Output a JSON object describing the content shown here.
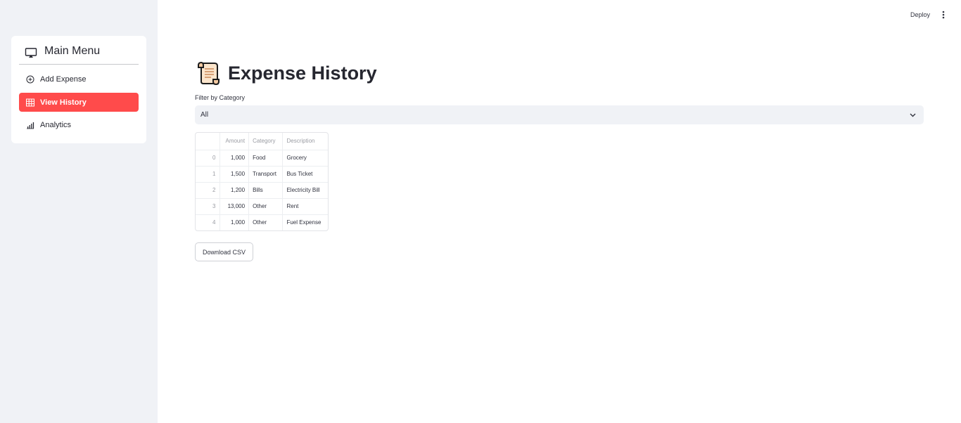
{
  "header": {
    "deploy_label": "Deploy",
    "menu_icon": "kebab-icon"
  },
  "sidebar": {
    "menu_title": "Main Menu",
    "menu_icon": "cast-icon",
    "items": [
      {
        "label": "Add Expense",
        "icon": "plus-circle-icon",
        "active": false
      },
      {
        "label": "View History",
        "icon": "table-icon",
        "active": true
      },
      {
        "label": "Analytics",
        "icon": "bar-chart-icon",
        "active": false
      }
    ]
  },
  "main": {
    "title_icon": "scroll-icon",
    "title": "Expense History",
    "filter": {
      "label": "Filter by Category",
      "value": "All"
    },
    "table": {
      "columns": [
        "",
        "Amount",
        "Category",
        "Description"
      ],
      "rows": [
        {
          "index": "0",
          "amount": "1,000",
          "category": "Food",
          "description": "Grocery"
        },
        {
          "index": "1",
          "amount": "1,500",
          "category": "Transport",
          "description": "Bus Ticket"
        },
        {
          "index": "2",
          "amount": "1,200",
          "category": "Bills",
          "description": "Electricity Bill"
        },
        {
          "index": "3",
          "amount": "13,000",
          "category": "Other",
          "description": "Rent"
        },
        {
          "index": "4",
          "amount": "1,000",
          "category": "Other",
          "description": "Fuel Expense"
        }
      ]
    },
    "download_label": "Download CSV"
  },
  "colors": {
    "accent": "#ff4b4b",
    "sidebar_bg": "#f0f2f6",
    "text": "#31333f"
  }
}
